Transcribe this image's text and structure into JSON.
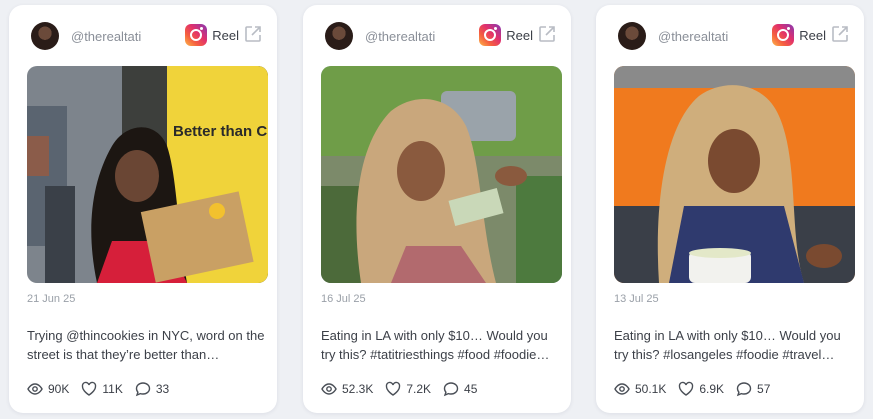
{
  "cards": [
    {
      "handle": "@therealtati",
      "type": "Reel",
      "date": "21 Jun 25",
      "caption": "Trying @thincookies in NYC, word on the street is that they’re better than…",
      "views": "90K",
      "likes": "11K",
      "comments": "33",
      "thumbnail_text": "Better than Crumbl."
    },
    {
      "handle": "@therealtati",
      "type": "Reel",
      "date": "16 Jul 25",
      "caption": "Eating in LA with only $10… Would you try this? #tatitriesthings #food #foodie…",
      "views": "52.3K",
      "likes": "7.2K",
      "comments": "45"
    },
    {
      "handle": "@therealtati",
      "type": "Reel",
      "date": "13 Jul 25",
      "caption": "Eating in LA with only $10… Would you try this? #losangeles #foodie #travel…",
      "views": "50.1K",
      "likes": "6.9K",
      "comments": "57"
    }
  ]
}
